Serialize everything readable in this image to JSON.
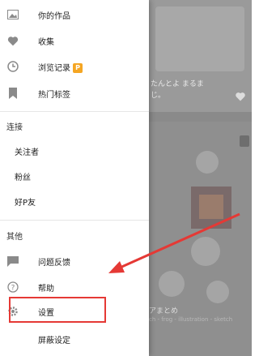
{
  "menu": {
    "works": "你的作品",
    "favorites": "收集",
    "history": "浏览记录",
    "history_badge": "P",
    "popular_tags": "热门标签"
  },
  "connections": {
    "header": "连接",
    "following": "关注者",
    "fans": "粉丝",
    "mypixiv": "好P友"
  },
  "other": {
    "header": "其他",
    "feedback": "问题反馈",
    "help": "帮助",
    "settings": "设置",
    "mute_settings": "屏蔽设定"
  },
  "background": {
    "caption_line1": "たんとよ まるま",
    "caption_line2": "じ。",
    "caption_b": "アまとめ",
    "caption_c": "ch - frog - illustration - sketch"
  },
  "colors": {
    "icon_gray": "#8a8a8a",
    "badge": "#f5a623",
    "highlight_red": "#e53935"
  }
}
